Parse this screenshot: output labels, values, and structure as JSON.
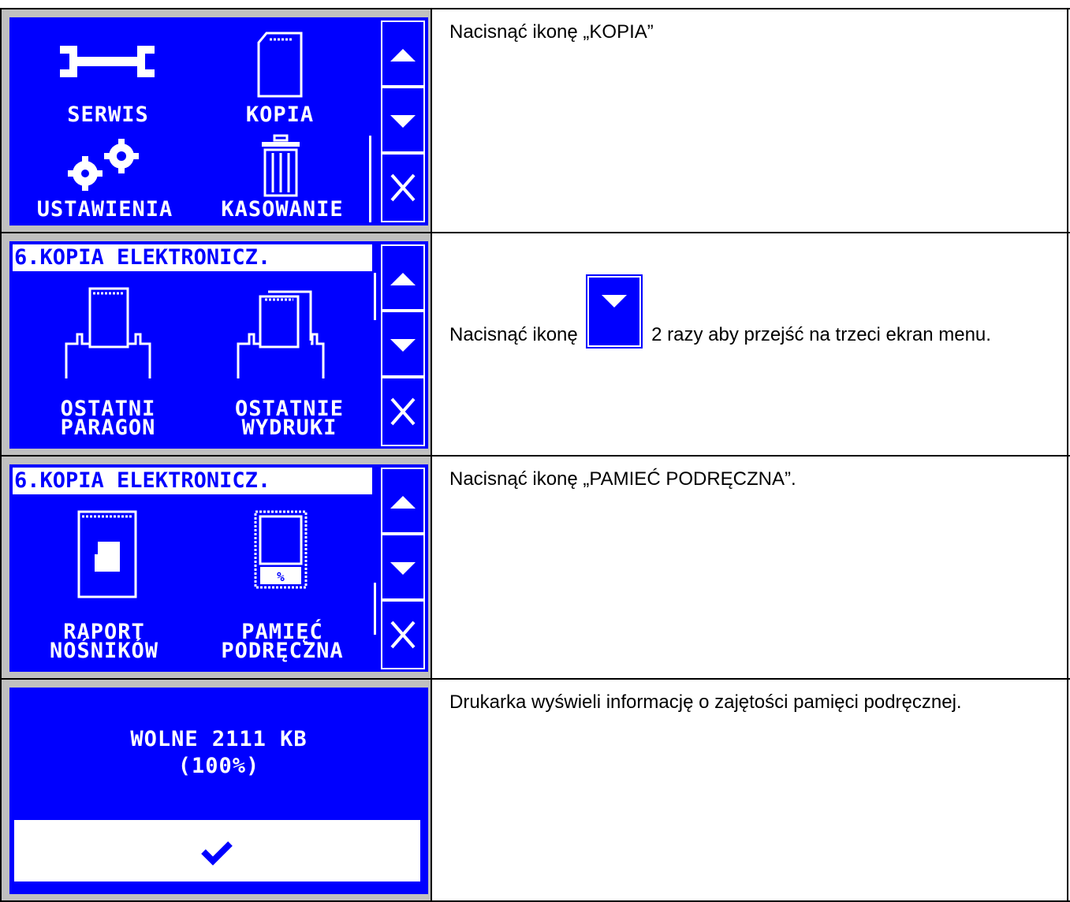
{
  "colors": {
    "lcd_bg": "#0000ff",
    "lcd_fg": "#ffffff",
    "cell_bg": "#c0c0c0"
  },
  "rows": [
    {
      "screen": {
        "items": [
          {
            "label": "SERWIS",
            "icon": "wrench-icon"
          },
          {
            "label": "KOPIA",
            "icon": "sd-card-icon"
          },
          {
            "label": "USTAWIENIA",
            "icon": "gears-icon"
          },
          {
            "label": "KASOWANIE",
            "icon": "trash-icon"
          }
        ]
      },
      "text": "Nacisnąć ikonę „KOPIA”"
    },
    {
      "screen": {
        "header": "6.KOPIA ELEKTRONICZ.",
        "items": [
          {
            "label_1": "OSTATNI",
            "label_2": "PARAGON",
            "icon": "printer-receipt-icon"
          },
          {
            "label_1": "OSTATNIE",
            "label_2": "WYDRUKI",
            "icon": "printer-receipts-icon"
          }
        ]
      },
      "text_before": "Nacisnąć ikonę",
      "text_after": "2 razy aby przejść na trzeci ekran menu."
    },
    {
      "screen": {
        "header": "6.KOPIA ELEKTRONICZ.",
        "items": [
          {
            "label_1": "RAPORT",
            "label_2": "NOŚNIKÓW",
            "icon": "media-report-icon"
          },
          {
            "label_1": "PAMIĘĆ",
            "label_2": "PODRĘCZNA",
            "icon": "memory-icon",
            "icon_text": "%"
          }
        ]
      },
      "text": "Nacisnąć ikonę „PAMIEĆ PODRĘCZNA”."
    },
    {
      "screen": {
        "line_1": "WOLNE 2111 KB",
        "line_2": "(100%)",
        "confirm_icon": "checkmark-icon"
      },
      "text": "Drukarka wyświeli informację o zajętości pamięci podręcznej."
    }
  ],
  "side_buttons": [
    "up-arrow-icon",
    "down-arrow-icon",
    "close-icon"
  ]
}
